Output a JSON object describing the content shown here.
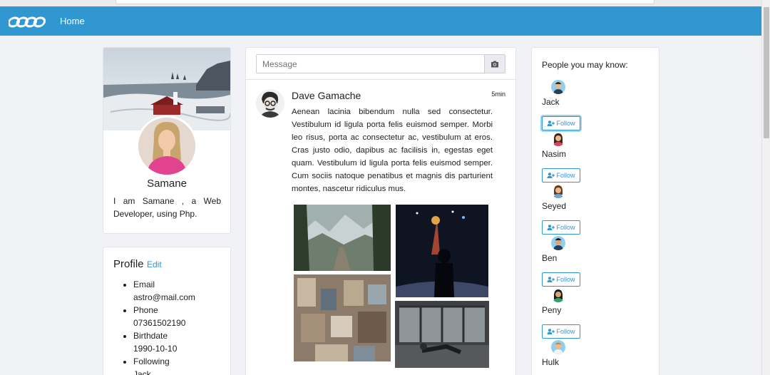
{
  "nav": {
    "home_label": "Home",
    "logo_icon": "chain-link-logo-icon"
  },
  "profile": {
    "name": "Samane",
    "bio": "I am Samane , a Web Developer, using Php."
  },
  "info": {
    "title": "Profile",
    "edit_label": "Edit",
    "items": [
      {
        "label": "Email",
        "value": "astro@mail.com"
      },
      {
        "label": "Phone",
        "value": "07361502190"
      },
      {
        "label": "Birthdate",
        "value": "1990-10-10"
      },
      {
        "label": "Following",
        "value": "Jack"
      }
    ]
  },
  "composer": {
    "placeholder": "Message",
    "camera_icon": "camera-icon"
  },
  "post": {
    "author": "Dave Gamache",
    "time": "5min",
    "text": "Aenean lacinia bibendum nulla sed consectetur. Vestibulum id ligula porta felis euismod semper. Morbi leo risus, porta ac consectetur ac, vestibulum at eros. Cras justo odio, dapibus ac facilisis in, egestas eget quam. Vestibulum id ligula porta felis euismod semper. Cum sociis natoque penatibus et magnis dis parturient montes, nascetur ridiculus mus."
  },
  "people": {
    "title": "People you may know:",
    "follow_label": "Follow",
    "list": [
      {
        "name": "Jack"
      },
      {
        "name": "Nasim"
      },
      {
        "name": "Seyed"
      },
      {
        "name": "Ben"
      },
      {
        "name": "Peny"
      },
      {
        "name": "Hulk"
      }
    ]
  },
  "colors": {
    "accent": "#3097d1",
    "background": "#f0f2f5"
  }
}
